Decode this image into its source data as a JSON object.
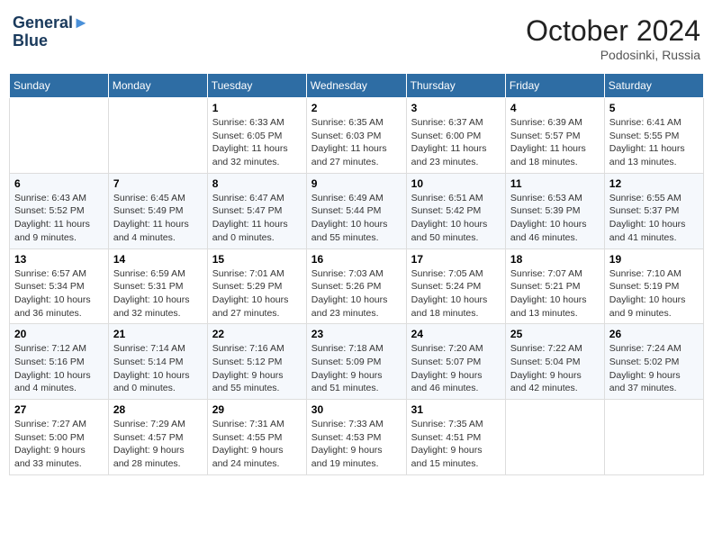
{
  "header": {
    "logo_line1": "General",
    "logo_line2": "Blue",
    "month": "October 2024",
    "location": "Podosinki, Russia"
  },
  "days_of_week": [
    "Sunday",
    "Monday",
    "Tuesday",
    "Wednesday",
    "Thursday",
    "Friday",
    "Saturday"
  ],
  "weeks": [
    [
      {
        "day": "",
        "info": ""
      },
      {
        "day": "",
        "info": ""
      },
      {
        "day": "1",
        "info": "Sunrise: 6:33 AM\nSunset: 6:05 PM\nDaylight: 11 hours\nand 32 minutes."
      },
      {
        "day": "2",
        "info": "Sunrise: 6:35 AM\nSunset: 6:03 PM\nDaylight: 11 hours\nand 27 minutes."
      },
      {
        "day": "3",
        "info": "Sunrise: 6:37 AM\nSunset: 6:00 PM\nDaylight: 11 hours\nand 23 minutes."
      },
      {
        "day": "4",
        "info": "Sunrise: 6:39 AM\nSunset: 5:57 PM\nDaylight: 11 hours\nand 18 minutes."
      },
      {
        "day": "5",
        "info": "Sunrise: 6:41 AM\nSunset: 5:55 PM\nDaylight: 11 hours\nand 13 minutes."
      }
    ],
    [
      {
        "day": "6",
        "info": "Sunrise: 6:43 AM\nSunset: 5:52 PM\nDaylight: 11 hours\nand 9 minutes."
      },
      {
        "day": "7",
        "info": "Sunrise: 6:45 AM\nSunset: 5:49 PM\nDaylight: 11 hours\nand 4 minutes."
      },
      {
        "day": "8",
        "info": "Sunrise: 6:47 AM\nSunset: 5:47 PM\nDaylight: 11 hours\nand 0 minutes."
      },
      {
        "day": "9",
        "info": "Sunrise: 6:49 AM\nSunset: 5:44 PM\nDaylight: 10 hours\nand 55 minutes."
      },
      {
        "day": "10",
        "info": "Sunrise: 6:51 AM\nSunset: 5:42 PM\nDaylight: 10 hours\nand 50 minutes."
      },
      {
        "day": "11",
        "info": "Sunrise: 6:53 AM\nSunset: 5:39 PM\nDaylight: 10 hours\nand 46 minutes."
      },
      {
        "day": "12",
        "info": "Sunrise: 6:55 AM\nSunset: 5:37 PM\nDaylight: 10 hours\nand 41 minutes."
      }
    ],
    [
      {
        "day": "13",
        "info": "Sunrise: 6:57 AM\nSunset: 5:34 PM\nDaylight: 10 hours\nand 36 minutes."
      },
      {
        "day": "14",
        "info": "Sunrise: 6:59 AM\nSunset: 5:31 PM\nDaylight: 10 hours\nand 32 minutes."
      },
      {
        "day": "15",
        "info": "Sunrise: 7:01 AM\nSunset: 5:29 PM\nDaylight: 10 hours\nand 27 minutes."
      },
      {
        "day": "16",
        "info": "Sunrise: 7:03 AM\nSunset: 5:26 PM\nDaylight: 10 hours\nand 23 minutes."
      },
      {
        "day": "17",
        "info": "Sunrise: 7:05 AM\nSunset: 5:24 PM\nDaylight: 10 hours\nand 18 minutes."
      },
      {
        "day": "18",
        "info": "Sunrise: 7:07 AM\nSunset: 5:21 PM\nDaylight: 10 hours\nand 13 minutes."
      },
      {
        "day": "19",
        "info": "Sunrise: 7:10 AM\nSunset: 5:19 PM\nDaylight: 10 hours\nand 9 minutes."
      }
    ],
    [
      {
        "day": "20",
        "info": "Sunrise: 7:12 AM\nSunset: 5:16 PM\nDaylight: 10 hours\nand 4 minutes."
      },
      {
        "day": "21",
        "info": "Sunrise: 7:14 AM\nSunset: 5:14 PM\nDaylight: 10 hours\nand 0 minutes."
      },
      {
        "day": "22",
        "info": "Sunrise: 7:16 AM\nSunset: 5:12 PM\nDaylight: 9 hours\nand 55 minutes."
      },
      {
        "day": "23",
        "info": "Sunrise: 7:18 AM\nSunset: 5:09 PM\nDaylight: 9 hours\nand 51 minutes."
      },
      {
        "day": "24",
        "info": "Sunrise: 7:20 AM\nSunset: 5:07 PM\nDaylight: 9 hours\nand 46 minutes."
      },
      {
        "day": "25",
        "info": "Sunrise: 7:22 AM\nSunset: 5:04 PM\nDaylight: 9 hours\nand 42 minutes."
      },
      {
        "day": "26",
        "info": "Sunrise: 7:24 AM\nSunset: 5:02 PM\nDaylight: 9 hours\nand 37 minutes."
      }
    ],
    [
      {
        "day": "27",
        "info": "Sunrise: 7:27 AM\nSunset: 5:00 PM\nDaylight: 9 hours\nand 33 minutes."
      },
      {
        "day": "28",
        "info": "Sunrise: 7:29 AM\nSunset: 4:57 PM\nDaylight: 9 hours\nand 28 minutes."
      },
      {
        "day": "29",
        "info": "Sunrise: 7:31 AM\nSunset: 4:55 PM\nDaylight: 9 hours\nand 24 minutes."
      },
      {
        "day": "30",
        "info": "Sunrise: 7:33 AM\nSunset: 4:53 PM\nDaylight: 9 hours\nand 19 minutes."
      },
      {
        "day": "31",
        "info": "Sunrise: 7:35 AM\nSunset: 4:51 PM\nDaylight: 9 hours\nand 15 minutes."
      },
      {
        "day": "",
        "info": ""
      },
      {
        "day": "",
        "info": ""
      }
    ]
  ]
}
